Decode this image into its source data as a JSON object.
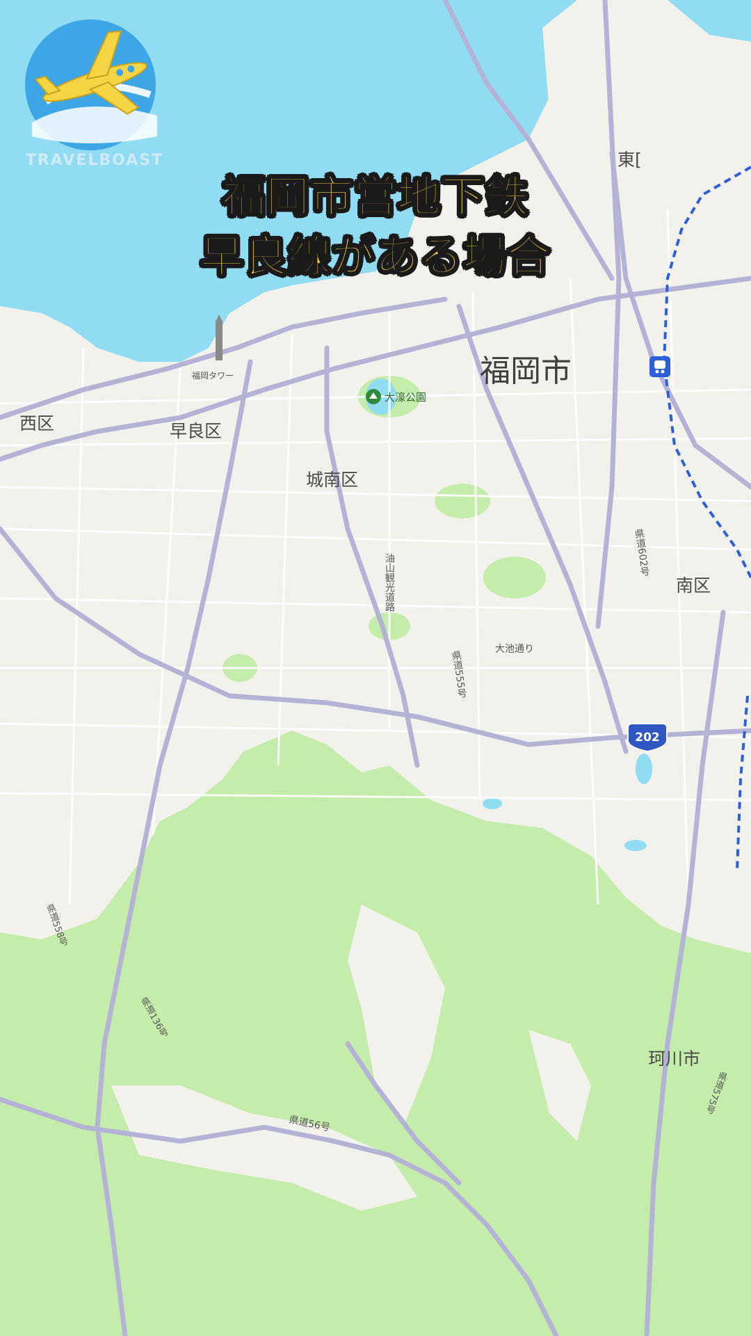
{
  "title": {
    "line1": "福岡市営地下鉄",
    "line2": "早良線がある場合"
  },
  "logo": {
    "text": "TRAVELBOAST",
    "icon": "airplane-icon"
  },
  "map": {
    "city_label": "福岡市",
    "districts": {
      "nishi": "西区",
      "sawara": "早良区",
      "jonan": "城南区",
      "minami": "南区",
      "higashi": "東[",
      "nakagawa": "珂川市"
    },
    "poi": {
      "park": "大濠公園",
      "tower": "福岡タワー"
    },
    "roads": {
      "aburayama": "油山観光道路",
      "ken555": "県道555号",
      "ken602": "県道602号",
      "oike": "大池通り",
      "route202": "202",
      "ken558": "県道558号",
      "ken136": "県道136号",
      "ken56": "県道56号",
      "ken575": "県道575号"
    },
    "colors": {
      "sea": "#8fdcf3",
      "land": "#f3f1ec",
      "green": "#c4ecaa",
      "road": "#b4b3d6",
      "rail": "#2d5fd8",
      "route_shield": "#2f57c4"
    }
  }
}
